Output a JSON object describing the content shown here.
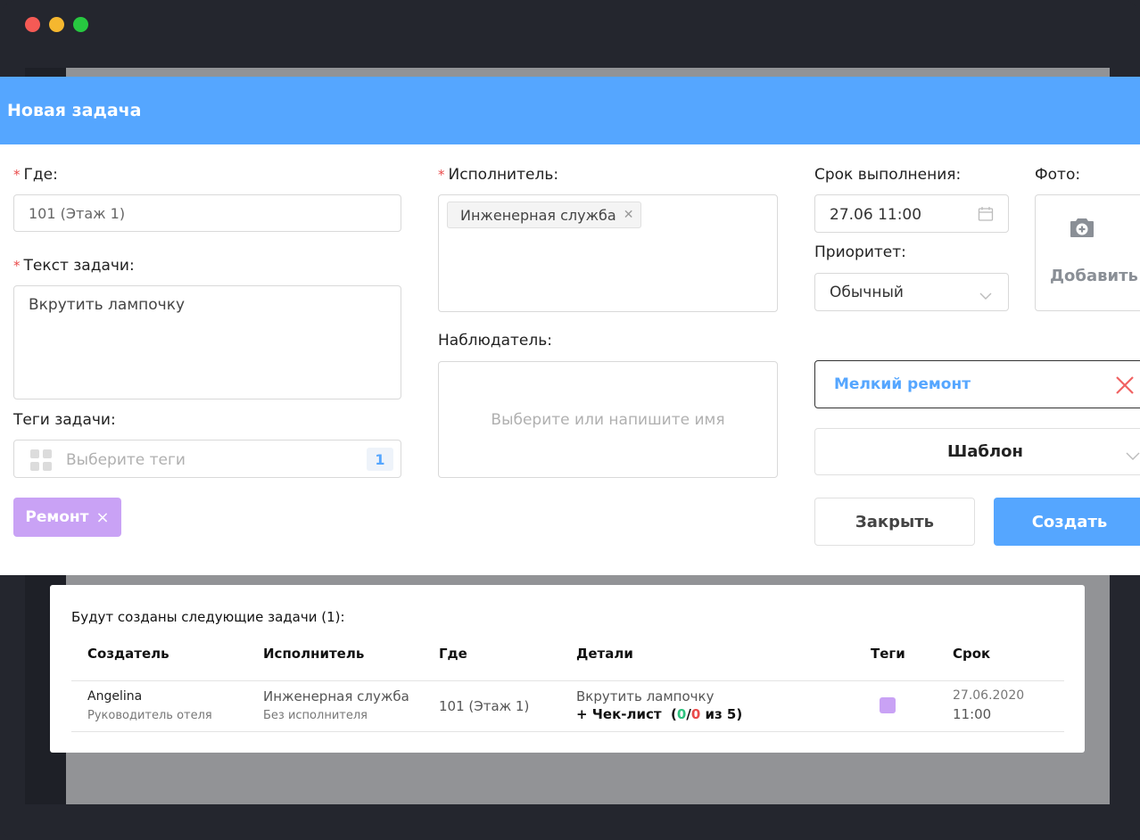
{
  "modal": {
    "title": "Новая задача",
    "where": {
      "label": "Где:",
      "value": "101 (Этаж 1)"
    },
    "task_text": {
      "label": "Текст задачи:",
      "value": "Вкрутить лампочку"
    },
    "tags": {
      "label": "Теги задачи:",
      "placeholder": "Выберите теги",
      "count": "1",
      "selected_tag": "Ремонт"
    },
    "executor": {
      "label": "Исполнитель:",
      "chip": "Инженерная служба"
    },
    "observer": {
      "label": "Наблюдатель:",
      "placeholder": "Выберите или напишите имя"
    },
    "deadline": {
      "label": "Срок выполнения:",
      "value": "27.06 11:00"
    },
    "priority": {
      "label": "Приоритет:",
      "value": "Обычный"
    },
    "photo": {
      "label": "Фото:",
      "add_label": "Добавить"
    },
    "category": {
      "value": "Мелкий ремонт"
    },
    "template": {
      "value": "Шаблон"
    },
    "close_label": "Закрыть",
    "create_label": "Создать"
  },
  "preview": {
    "title": "Будут созданы следующие задачи (1):",
    "columns": [
      "Создатель",
      "Исполнитель",
      "Где",
      "Детали",
      "Теги",
      "Срок"
    ],
    "row": {
      "creator_name": "Angelina",
      "creator_role": "Руководитель отеля",
      "executor_name": "Инженерная служба",
      "executor_sub": "Без исполнителя",
      "where": "101 (Этаж 1)",
      "details": "Вкрутить лампочку",
      "checklist_prefix": "+ Чек-лист",
      "checklist_done": "0",
      "checklist_failed": "0",
      "checklist_total": "из 5",
      "deadline_date": "27.06.2020",
      "deadline_time": "11:00",
      "tag_color": "#c9a2f5"
    }
  },
  "colors": {
    "accent": "#55a6ff",
    "required": "#e94a4a",
    "tag_purple": "#c9a2f5",
    "green": "#2ec27e",
    "red": "#e94a4a"
  }
}
